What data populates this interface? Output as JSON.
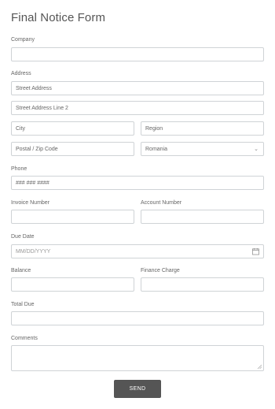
{
  "form": {
    "title": "Final Notice Form",
    "company": {
      "label": "Company",
      "value": ""
    },
    "address": {
      "label": "Address",
      "street": "Street Address",
      "street2": "Street Address Line 2",
      "city": "City",
      "region": "Region",
      "postal": "Postal / Zip Code",
      "country": "Romania"
    },
    "phone": {
      "label": "Phone",
      "placeholder": "### ### ####"
    },
    "invoice_number": {
      "label": "Invoice Number",
      "value": ""
    },
    "account_number": {
      "label": "Account Number",
      "value": ""
    },
    "due_date": {
      "label": "Due Date",
      "placeholder": "MM/DD/YYYY"
    },
    "balance": {
      "label": "Balance",
      "value": ""
    },
    "finance_charge": {
      "label": "Finance Charge",
      "value": ""
    },
    "total_due": {
      "label": "Total Due",
      "value": ""
    },
    "comments": {
      "label": "Comments",
      "value": ""
    },
    "send_label": "SEND"
  },
  "icons": {
    "country_dropdown": "chevron-down-icon",
    "due_date": "calendar-icon",
    "comments_resize": "resize-handle-icon"
  }
}
